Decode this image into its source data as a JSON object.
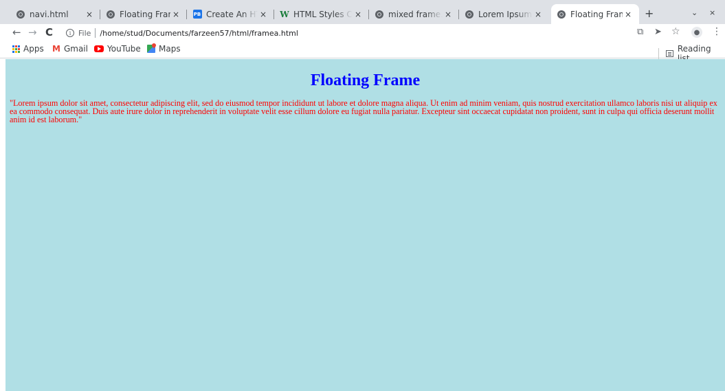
{
  "tabs": [
    {
      "title": "navi.html",
      "favicon": "globe-icon"
    },
    {
      "title": "Floating Frame",
      "favicon": "globe-icon"
    },
    {
      "title": "Create An HTML",
      "favicon": "pb-icon"
    },
    {
      "title": "HTML Styles CS",
      "favicon": "w3-icon"
    },
    {
      "title": "mixed frame.ht",
      "favicon": "globe-icon"
    },
    {
      "title": "Lorem Ipsum - A",
      "favicon": "globe-icon"
    },
    {
      "title": "Floating Frame",
      "favicon": "globe-icon",
      "active": true
    }
  ],
  "tab_close_glyph": "×",
  "favicon_labels": {
    "pb": "PB",
    "w3": "W"
  },
  "new_tab_glyph": "+",
  "tab_controls": {
    "search": "⌄",
    "close": "×"
  },
  "toolbar": {
    "back_glyph": "←",
    "forward_glyph": "→",
    "reload_glyph": "C",
    "info_glyph": "i",
    "scheme_label": "File",
    "url": "/home/stud/Documents/farzeen57/html/framea.html",
    "translate_glyph": "⧉",
    "send_glyph": "➤",
    "star_glyph": "☆",
    "avatar_glyph": "●",
    "menu_glyph": "⋮"
  },
  "bookmarks": {
    "apps": "Apps",
    "gmail_glyph": "M",
    "gmail": "Gmail",
    "youtube": "YouTube",
    "maps": "Maps",
    "reading_list": "Reading list"
  },
  "page": {
    "heading": "Floating Frame",
    "paragraph": "\"Lorem ipsum dolor sit amet, consectetur adipiscing elit, sed do eiusmod tempor incididunt ut labore et dolore magna aliqua. Ut enim ad minim veniam, quis nostrud exercitation ullamco laboris nisi ut aliquip ex ea commodo consequat. Duis aute irure dolor in reprehenderit in voluptate velit esse cillum dolore eu fugiat nulla pariatur. Excepteur sint occaecat cupidatat non proident, sunt in culpa qui officia deserunt mollit anim id est laborum.\"",
    "background": "#b0dfe5",
    "heading_color": "#0000ff",
    "text_color": "#ff0000"
  }
}
